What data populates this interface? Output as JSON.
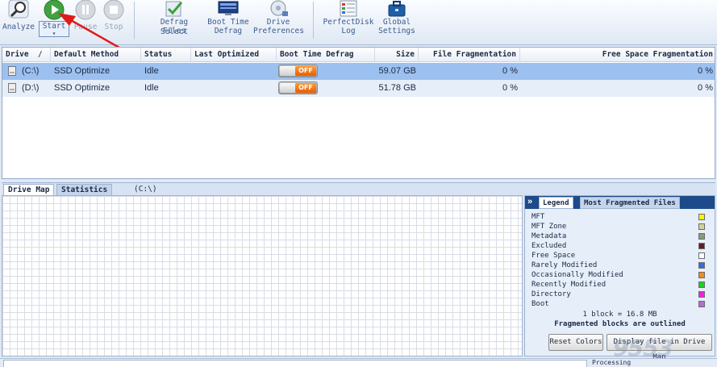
{
  "toolbar": {
    "analyze": "Analyze",
    "start": "Start",
    "pause": "Pause",
    "stop": "Stop",
    "defrag_select_1": "Defrag Select",
    "defrag_select_2": "Files",
    "boot_time_1": "Boot Time",
    "boot_time_2": "Defrag",
    "drive_prefs_1": "Drive",
    "drive_prefs_2": "Preferences",
    "perfectdisk_1": "PerfectDisk",
    "perfectdisk_2": "Log",
    "global_1": "Global",
    "global_2": "Settings",
    "start_arrow": "▾"
  },
  "table": {
    "headers": {
      "drive": "Drive",
      "sort": "/",
      "method": "Default Method",
      "status": "Status",
      "last": "Last Optimized",
      "boot": "Boot Time Defrag",
      "size": "Size",
      "filefrag": "File Fragmentation",
      "freefrag": "Free Space Fragmentation"
    },
    "rows": [
      {
        "drive": "(C:\\)",
        "method": "SSD Optimize",
        "status": "Idle",
        "last": "",
        "boot": "OFF",
        "size": "59.07 GB",
        "filefrag": "0 %",
        "freefrag": "0 %"
      },
      {
        "drive": "(D:\\)",
        "method": "SSD Optimize",
        "status": "Idle",
        "last": "",
        "boot": "OFF",
        "size": "51.78 GB",
        "filefrag": "0 %",
        "freefrag": "0 %"
      }
    ]
  },
  "tabs": {
    "drive_map": "Drive Map",
    "statistics": "Statistics",
    "current_drive": "(C:\\)"
  },
  "legend_panel": {
    "collapse": "»",
    "legend_tab": "Legend",
    "most_frag_tab": "Most Fragmented Files",
    "items": [
      {
        "label": "MFT",
        "color": "#f4f40c"
      },
      {
        "label": "MFT Zone",
        "color": "#d2d49a"
      },
      {
        "label": "Metadata",
        "color": "#8a9a7a"
      },
      {
        "label": "Excluded",
        "color": "#5a2020"
      },
      {
        "label": "Free Space",
        "color": "#ffffff"
      },
      {
        "label": "Rarely Modified",
        "color": "#3a6ae0"
      },
      {
        "label": "Occasionally Modified",
        "color": "#f08a20"
      },
      {
        "label": "Recently Modified",
        "color": "#20d020"
      },
      {
        "label": "Directory",
        "color": "#f020e0"
      },
      {
        "label": "Boot",
        "color": "#b070d0"
      }
    ],
    "block_size": "1 block = 16.8 MB",
    "outlined_note": "Fragmented blocks are outlined",
    "reset_colors": "Reset Colors",
    "display_file": "Display file in Drive Map"
  },
  "status_bar": {
    "progress_label": "Processing"
  },
  "watermark": "9553"
}
